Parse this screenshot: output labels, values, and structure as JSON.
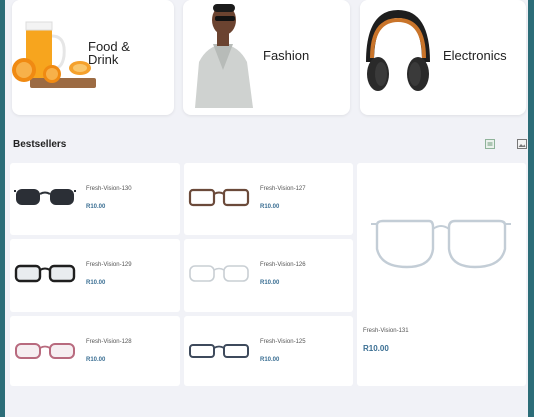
{
  "categories": [
    {
      "label_line1": "Food &",
      "label_line2": "Drink",
      "icon": "juice-oranges-image"
    },
    {
      "label": "Fashion",
      "icon": "fashion-model-image"
    },
    {
      "label": "Electronics",
      "icon": "headphones-image"
    }
  ],
  "bestsellers": {
    "title": "Bestsellers",
    "products": [
      {
        "name": "Fresh-Vision-130",
        "price": "R10.00",
        "frame_color": "#2b2f36"
      },
      {
        "name": "Fresh-Vision-127",
        "price": "R10.00",
        "frame_color": "#6b4a3a"
      },
      {
        "name": "Fresh-Vision-129",
        "price": "R10.00",
        "frame_color": "#1f1f1f"
      },
      {
        "name": "Fresh-Vision-126",
        "price": "R10.00",
        "frame_color": "#c9cfd4"
      },
      {
        "name": "Fresh-Vision-128",
        "price": "R10.00",
        "frame_color": "#b86a7e"
      },
      {
        "name": "Fresh-Vision-125",
        "price": "R10.00",
        "frame_color": "#3e4a5c"
      }
    ],
    "featured": {
      "name": "Fresh-Vision-131",
      "price": "R10.00",
      "frame_color": "#c3cdd6"
    }
  },
  "colors": {
    "accent_price": "#3b6f93",
    "page_bg": "#f1f2f7",
    "outer_bg": "#2c6d78"
  }
}
